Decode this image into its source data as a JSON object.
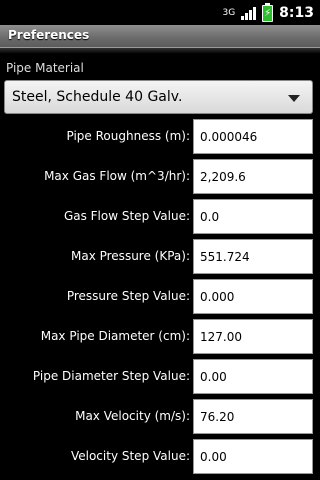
{
  "status_bar": {
    "network_label": "3G",
    "time": "8:13",
    "signal_icon": "signal-bars-icon",
    "battery_icon": "battery-charging-icon"
  },
  "title_bar": {
    "title": "Preferences"
  },
  "pipe_material": {
    "label": "Pipe Material",
    "selected": "Steel, Schedule 40 Galv."
  },
  "fields": [
    {
      "label": "Pipe Roughness (m):",
      "value": "0.000046"
    },
    {
      "label": "Max Gas Flow (m^3/hr):",
      "value": "2,209.6"
    },
    {
      "label": "Gas Flow Step Value:",
      "value": "0.0"
    },
    {
      "label": "Max Pressure (KPa):",
      "value": "551.724"
    },
    {
      "label": "Pressure Step Value:",
      "value": "0.000"
    },
    {
      "label": "Max Pipe Diameter (cm):",
      "value": "127.00"
    },
    {
      "label": "Pipe Diameter Step Value:",
      "value": "0.00"
    },
    {
      "label": "Max Velocity (m/s):",
      "value": "76.20"
    },
    {
      "label": "Velocity Step Value:",
      "value": "0.00"
    }
  ],
  "colors": {
    "background": "#000000",
    "battery": "#2cbf2c"
  }
}
